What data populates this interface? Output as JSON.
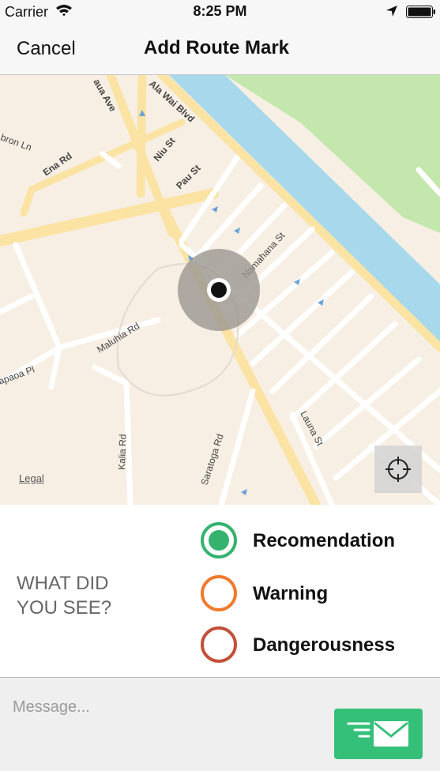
{
  "status_bar": {
    "carrier": "Carrier",
    "time": "8:25 PM",
    "wifi_icon": "wifi-icon",
    "location_icon": "location-arrow-icon",
    "battery_icon": "battery-icon"
  },
  "nav": {
    "cancel_label": "Cancel",
    "title": "Add Route Mark"
  },
  "map": {
    "legal_label": "Legal",
    "locate_icon": "crosshair-icon",
    "street_labels": {
      "ala_wai": "Ala Wai Blvd",
      "niu": "Niu St",
      "pau": "Pau St",
      "ena": "Ena Rd",
      "bron": "bron Ln",
      "kaua": "aua Ave",
      "namahana": "Namahana St",
      "maluhia": "Maluhia Rd",
      "kapaoa": "apaoa Pl",
      "kalia": "Kalia Rd",
      "saratoga": "Saratoga Rd",
      "launa": "Launa St"
    },
    "colors": {
      "land": "#f7efe4",
      "water": "#a8d8ec",
      "park": "#c3e7ad",
      "major_road": "#fbe3a4",
      "minor_road": "#ffffff",
      "accuracy_circle": "#9a9690"
    }
  },
  "panel": {
    "question": "WHAT DID YOU SEE?",
    "options": [
      {
        "label": "Recomendation",
        "color": "#35b36e",
        "selected": true
      },
      {
        "label": "Warning",
        "color": "#f07a2e",
        "selected": false
      },
      {
        "label": "Dangerousness",
        "color": "#c4503a",
        "selected": false
      }
    ]
  },
  "message": {
    "placeholder": "Message...",
    "send_icon": "send-mail-icon",
    "send_color": "#35c07a"
  }
}
